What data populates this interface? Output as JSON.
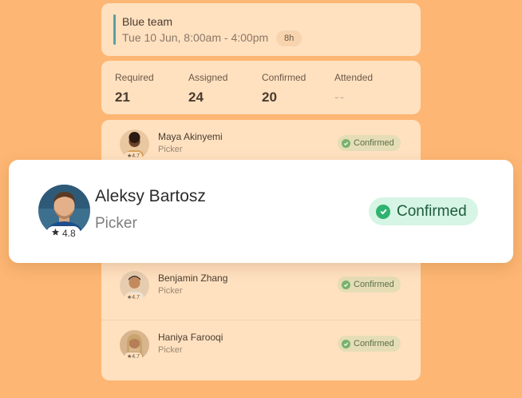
{
  "shift": {
    "team": "Blue team",
    "time": "Tue 10 Jun, 8:00am - 4:00pm",
    "hours": "8h",
    "accent_color": "#5E9EA0"
  },
  "stats": [
    {
      "label": "Required",
      "value": "21"
    },
    {
      "label": "Assigned",
      "value": "24"
    },
    {
      "label": "Confirmed",
      "value": "20"
    },
    {
      "label": "Attended",
      "value": "--"
    }
  ],
  "workers": [
    {
      "name": "Maya Akinyemi",
      "role": "Picker",
      "rating": "4.7",
      "status": "Confirmed"
    },
    {
      "name": "Benjamin Zhang",
      "role": "Picker",
      "rating": "4.7",
      "status": "Confirmed"
    },
    {
      "name": "Haniya Farooqi",
      "role": "Picker",
      "rating": "4.7",
      "status": "Confirmed"
    }
  ],
  "featured": {
    "name": "Aleksy Bartosz",
    "role": "Picker",
    "rating": "4.8",
    "status": "Confirmed"
  },
  "colors": {
    "background": "#FDB673",
    "card": "#FFE1C0",
    "confirmed_green": "#2FB36F"
  }
}
